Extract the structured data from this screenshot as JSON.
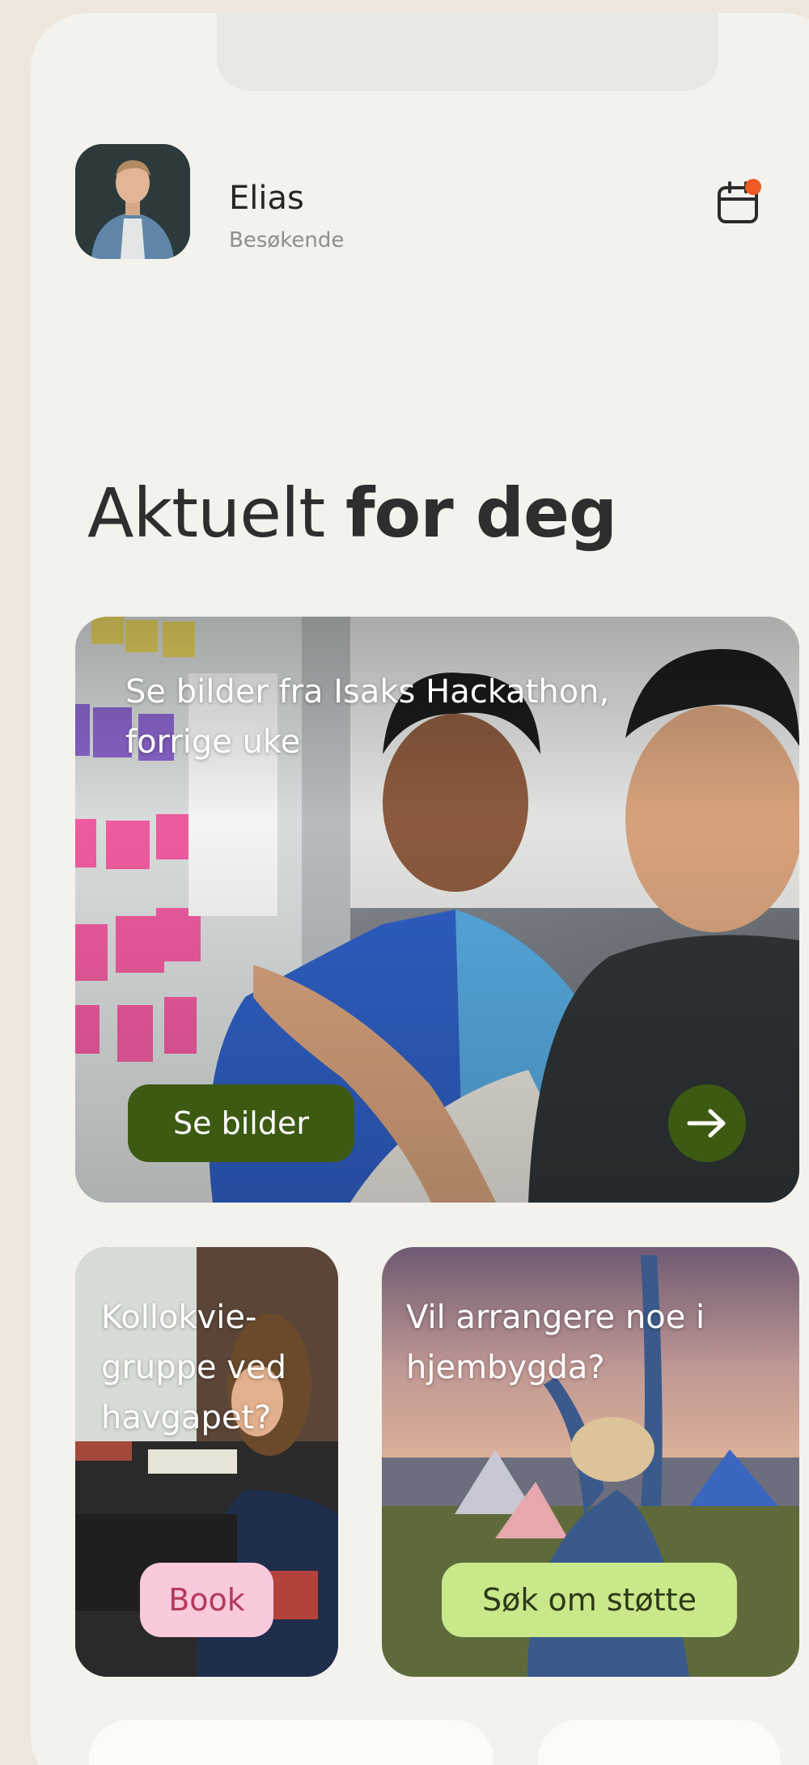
{
  "user": {
    "name": "Elias",
    "role": "Besøkende"
  },
  "heading": {
    "regular": "Aktuelt ",
    "bold": "for deg"
  },
  "featured_card": {
    "title": "Se bilder fra Isaks Hackathon, forrige uke",
    "button_label": "Se bilder",
    "arrow_icon": "arrow-right-icon"
  },
  "card_study": {
    "title": "Kollokvie-gruppe ved havgapet?",
    "button_label": "Book"
  },
  "card_event": {
    "title": "Vil arrangere noe i hjembygda?",
    "button_label": "Søk om støtte"
  },
  "colors": {
    "background": "#ede6dc",
    "phone": "#f3f2ed",
    "dark_green": "#3d5a12",
    "pink": "#f9c9dc",
    "pink_text": "#b33a5c",
    "lime": "#c8e88a",
    "notification_dot": "#f05a24"
  }
}
